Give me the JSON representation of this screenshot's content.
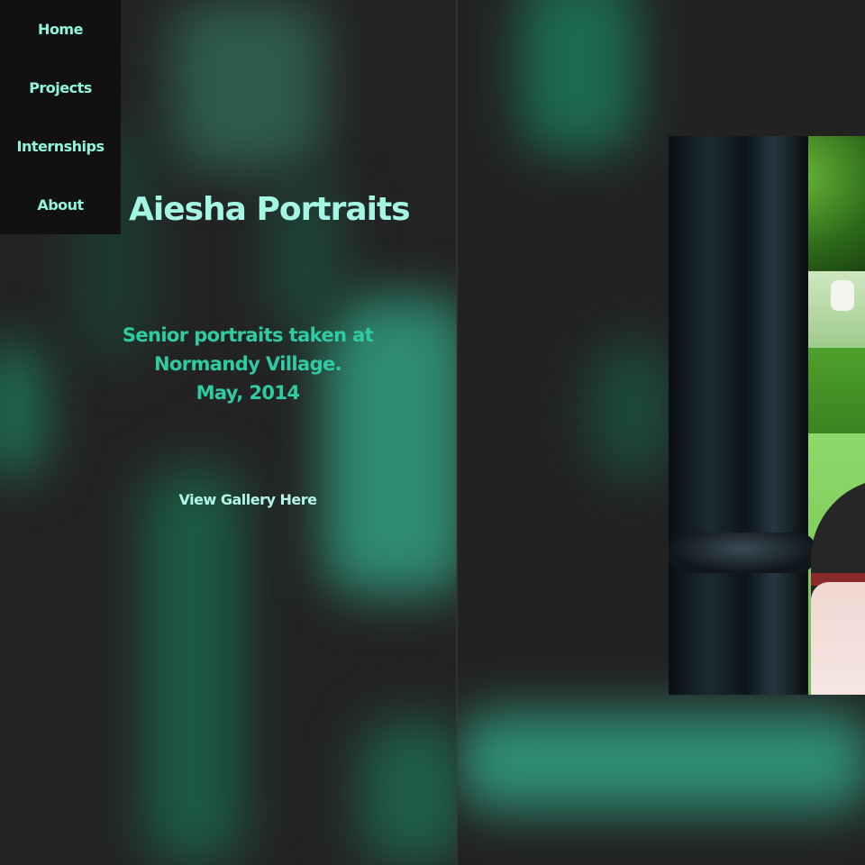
{
  "nav": {
    "items": [
      {
        "label": "Home"
      },
      {
        "label": "Projects"
      },
      {
        "label": "Internships"
      },
      {
        "label": "About"
      }
    ]
  },
  "project": {
    "title": "Aiesha Portraits",
    "description_lines": [
      "Senior portraits taken at",
      "Normandy Village.",
      "May, 2014"
    ],
    "gallery_link": "View Gallery Here"
  },
  "colors": {
    "background": "#222222",
    "nav_background": "#111111",
    "nav_text": "#8ff5dc",
    "title_text": "#a4f7e4",
    "description_text": "#2fcca3",
    "link_text": "#b4f7e8",
    "glow_green": "#2f8f6f"
  },
  "photo": {
    "subject": "portrait-photo"
  }
}
